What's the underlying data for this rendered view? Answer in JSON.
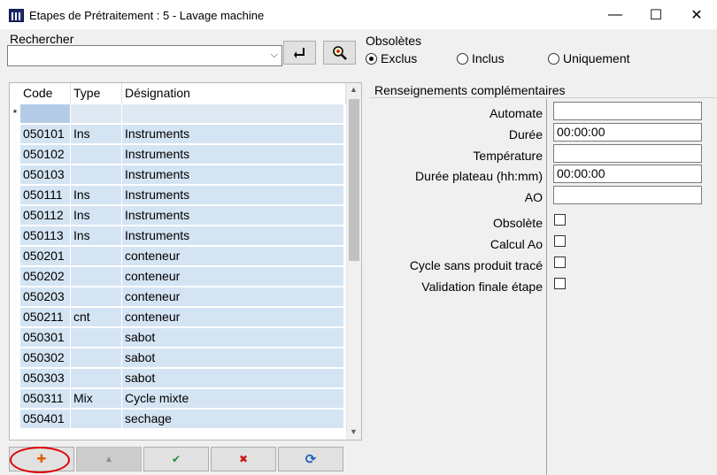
{
  "window": {
    "title": "Etapes de Prétraitement : 5 - Lavage machine",
    "minimize": "—",
    "maximize": "☐",
    "close": "✕"
  },
  "search": {
    "label": "Rechercher",
    "value": "",
    "placeholder": ""
  },
  "toolbar": {
    "enter_icon": "↲",
    "zoom_icon": "🔍"
  },
  "obsoletes": {
    "label": "Obsolètes",
    "options": [
      "Exclus",
      "Inclus",
      "Uniquement"
    ],
    "selected": "Exclus"
  },
  "grid": {
    "columns": [
      "Code",
      "Type",
      "Désignation"
    ],
    "new_row_marker": "*",
    "rows": [
      [
        "050101",
        "Ins",
        "Instruments"
      ],
      [
        "050102",
        "",
        "Instruments"
      ],
      [
        "050103",
        "",
        "Instruments"
      ],
      [
        "050111",
        "Ins",
        "Instruments"
      ],
      [
        "050112",
        "Ins",
        "Instruments"
      ],
      [
        "050113",
        "Ins",
        "Instruments"
      ],
      [
        "050201",
        "",
        "conteneur"
      ],
      [
        "050202",
        "",
        "conteneur"
      ],
      [
        "050203",
        "",
        "conteneur"
      ],
      [
        "050211",
        "cnt",
        "conteneur"
      ],
      [
        "050301",
        "",
        "sabot"
      ],
      [
        "050302",
        "",
        "sabot"
      ],
      [
        "050303",
        "",
        "sabot"
      ],
      [
        "050311",
        "Mix",
        "Cycle mixte"
      ],
      [
        "050401",
        "",
        "sechage"
      ]
    ]
  },
  "buttons": {
    "add": "✚",
    "up": "▲",
    "validate": "✔",
    "delete": "✖",
    "refresh": "⟳"
  },
  "colors": {
    "add": "#e06000",
    "up": "#8a8a8a",
    "validate": "#1e8a3c",
    "delete": "#d01818",
    "refresh": "#1e5fb8",
    "highlight": "#e00000"
  },
  "details": {
    "title": "Renseignements complémentaires",
    "automate_label": "Automate",
    "automate_value": "",
    "duree_label": "Durée",
    "duree_value": "00:00:00",
    "temperature_label": "Température",
    "temperature_value": "",
    "plateau_label": "Durée plateau (hh:mm)",
    "plateau_value": "00:00:00",
    "ao_label": "AO",
    "ao_value": "",
    "obsolete_label": "Obsolète",
    "calcul_label": "Calcul Ao",
    "cycle_label": "Cycle sans produit tracé",
    "validation_label": "Validation finale étape"
  }
}
